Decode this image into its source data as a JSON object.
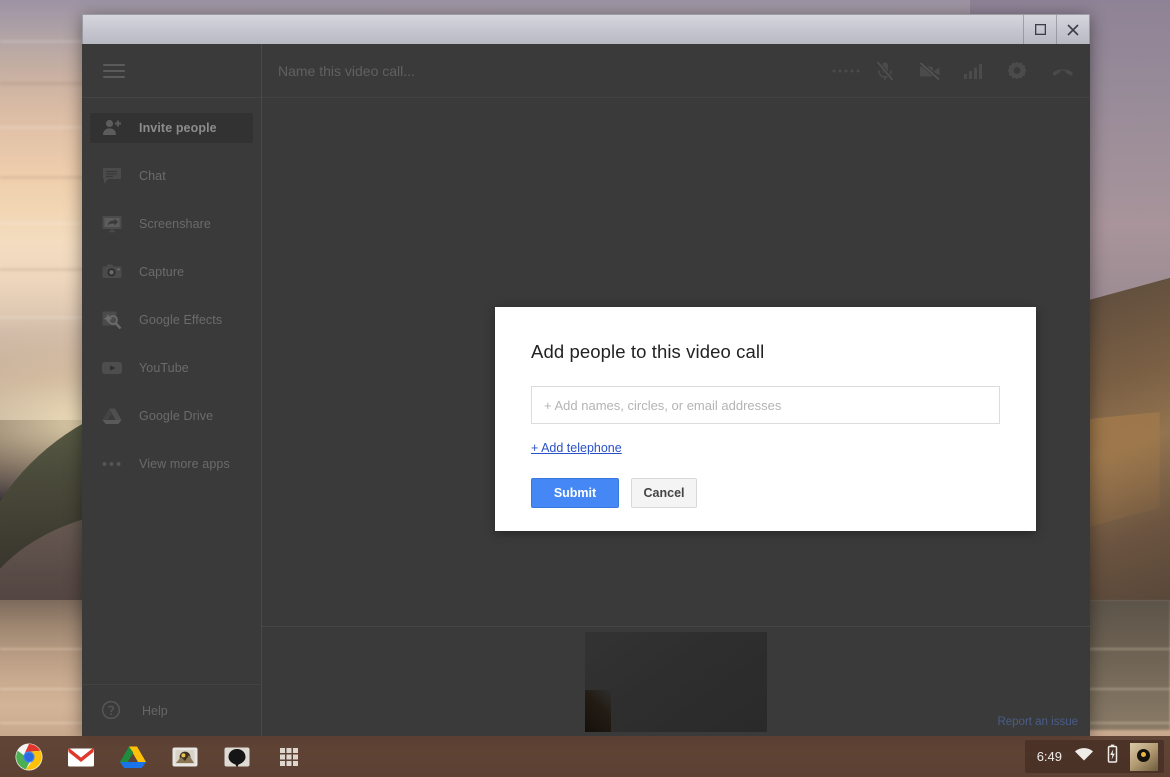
{
  "window": {
    "maximize_label": "Maximize",
    "close_label": "Close"
  },
  "app": {
    "call_name_placeholder": "Name this video call...",
    "menu_icon": "hamburger-menu-icon",
    "toolbar_icons": [
      {
        "name": "more-options-icon",
        "label": "More options"
      },
      {
        "name": "microphone-muted-icon",
        "label": "Mute microphone"
      },
      {
        "name": "camera-muted-icon",
        "label": "Turn off camera"
      },
      {
        "name": "bandwidth-icon",
        "label": "Bandwidth"
      },
      {
        "name": "settings-gear-icon",
        "label": "Settings"
      },
      {
        "name": "hang-up-icon",
        "label": "Leave call"
      }
    ]
  },
  "sidebar": {
    "items": [
      {
        "label": "Invite people",
        "icon": "add-person-icon",
        "active": true
      },
      {
        "label": "Chat",
        "icon": "chat-bubble-icon",
        "active": false
      },
      {
        "label": "Screenshare",
        "icon": "monitor-share-icon",
        "active": false
      },
      {
        "label": "Capture",
        "icon": "camera-icon",
        "active": false
      },
      {
        "label": "Google Effects",
        "icon": "google-effects-icon",
        "active": false
      },
      {
        "label": "YouTube",
        "icon": "youtube-icon",
        "active": false
      },
      {
        "label": "Google Drive",
        "icon": "google-drive-icon",
        "active": false
      },
      {
        "label": "View more apps",
        "icon": "three-dots-icon",
        "active": false
      }
    ],
    "help_label": "Help",
    "help_icon": "question-circle-icon"
  },
  "stage": {
    "report_link": "Report an issue"
  },
  "dialog": {
    "title": "Add people to this video call",
    "input_value": "",
    "input_placeholder": "+ Add names, circles, or email addresses",
    "add_telephone_label": "+ Add telephone",
    "submit_label": "Submit",
    "cancel_label": "Cancel",
    "submit_color": "#4587f4",
    "link_color": "#2a50c8"
  },
  "shelf": {
    "apps": [
      {
        "name": "chrome-icon",
        "label": "Google Chrome"
      },
      {
        "name": "gmail-icon",
        "label": "Gmail"
      },
      {
        "name": "google-drive-icon",
        "label": "Google Drive"
      },
      {
        "name": "photo-icon",
        "label": "Photos"
      },
      {
        "name": "balloon-icon",
        "label": "Hangouts"
      },
      {
        "name": "app-launcher-icon",
        "label": "App launcher"
      }
    ],
    "clock": "6:49",
    "wifi_icon": "wifi-icon",
    "battery_icon": "battery-icon",
    "avatar_icon": "user-avatar"
  }
}
